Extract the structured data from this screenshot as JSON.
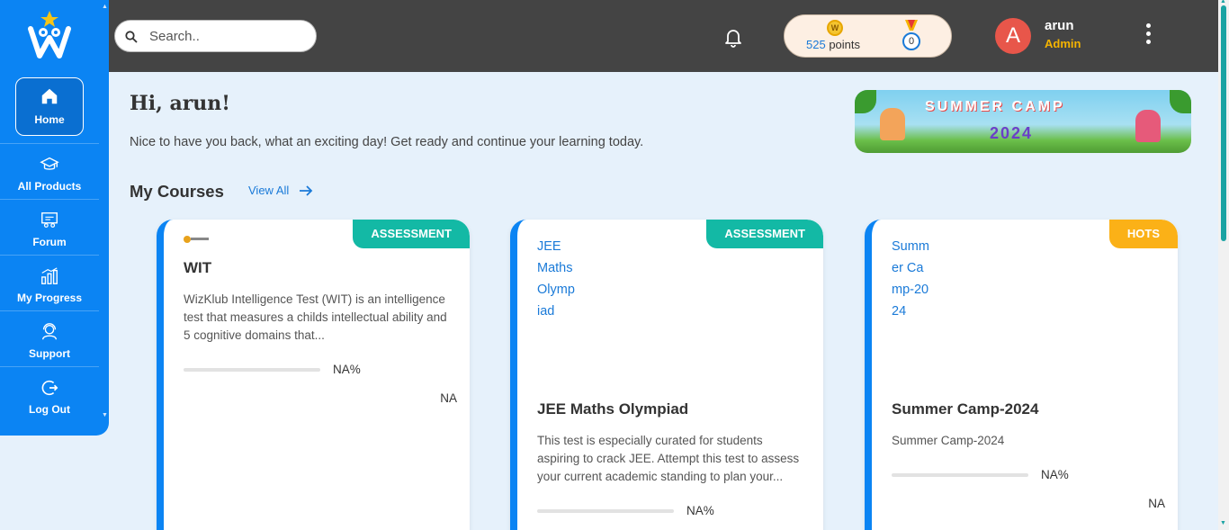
{
  "sidebar": {
    "items": [
      {
        "label": "Home",
        "icon": "home-icon"
      },
      {
        "label": "All Products",
        "icon": "graduation-cap-icon"
      },
      {
        "label": "Forum",
        "icon": "forum-icon"
      },
      {
        "label": "My Progress",
        "icon": "bar-chart-icon"
      },
      {
        "label": "Support",
        "icon": "headset-icon"
      },
      {
        "label": "Log Out",
        "icon": "logout-icon"
      }
    ]
  },
  "header": {
    "search_placeholder": "Search..",
    "points_value": "525",
    "points_label": "points",
    "coin_letter": "W",
    "medal_count": "0",
    "avatar_letter": "A",
    "user_name": "arun",
    "user_role": "Admin"
  },
  "main": {
    "greeting": "Hi, arun!",
    "subtitle": "Nice to have you back, what an exciting day! Get ready and continue your learning today.",
    "banner_title": "SUMMER CAMP",
    "banner_year": "2024",
    "courses_heading": "My Courses",
    "view_all": "View All",
    "courses": [
      {
        "tag": "ASSESSMENT",
        "image_alt": "",
        "title": "WIT",
        "description": "WizKlub Intelligence Test (WIT) is an intelligence test that measures a childs intellectual ability and 5 cognitive domains that...",
        "progress": "NA%",
        "status": "NA"
      },
      {
        "tag": "ASSESSMENT",
        "image_alt": "JEE Maths Olympiad",
        "title": "JEE Maths Olympiad",
        "description": "This test is especially curated for students aspiring to crack JEE. Attempt this test to assess your current academic standing to plan your...",
        "progress": "NA%",
        "status": ""
      },
      {
        "tag": "HOTS",
        "image_alt": "Summer Camp-2024",
        "title": "Summer Camp-2024",
        "description": "Summer Camp-2024",
        "progress": "NA%",
        "status": "NA"
      }
    ]
  },
  "colors": {
    "brand_blue": "#0b84f3",
    "header_bg": "#444444",
    "tag_teal": "#13b9a5",
    "tag_orange": "#fbb117",
    "role_gold": "#f5b400"
  }
}
